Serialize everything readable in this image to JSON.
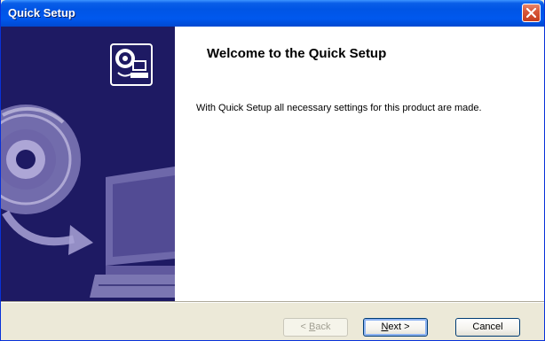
{
  "window": {
    "title": "Quick Setup",
    "close_icon": "close-icon"
  },
  "side_panel": {
    "logo_icon": "computer-with-disc-icon",
    "artwork": "disc-to-computer-graphic",
    "background_color": "#1e1a63"
  },
  "main": {
    "heading": "Welcome to the Quick Setup",
    "description": "With Quick Setup all necessary settings for this product are made."
  },
  "footer": {
    "back": {
      "mnemonic": "B",
      "rest": "ack",
      "prefix": "< ",
      "enabled": false
    },
    "next": {
      "mnemonic": "N",
      "rest": "ext",
      "suffix": " >",
      "enabled": true,
      "default": true
    },
    "cancel": {
      "label": "Cancel",
      "enabled": true
    }
  },
  "colors": {
    "title_bar": "#0055e5",
    "close_button": "#d8583a",
    "side_panel": "#1e1a63",
    "dialog_face": "#ece9d8"
  }
}
